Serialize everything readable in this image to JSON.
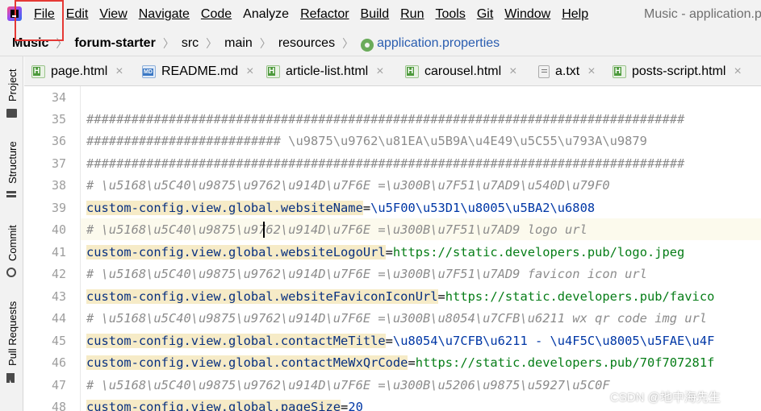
{
  "menubar": {
    "items": [
      {
        "label": "File"
      },
      {
        "label": "Edit"
      },
      {
        "label": "View"
      },
      {
        "label": "Navigate"
      },
      {
        "label": "Code"
      },
      {
        "label": "Analyze"
      },
      {
        "label": "Refactor"
      },
      {
        "label": "Build"
      },
      {
        "label": "Run"
      },
      {
        "label": "Tools"
      },
      {
        "label": "Git"
      },
      {
        "label": "Window"
      },
      {
        "label": "Help"
      }
    ],
    "window_title": "Music - application.p"
  },
  "breadcrumb": {
    "project": "Music",
    "module": "forum-starter",
    "dir1": "src",
    "dir2": "main",
    "dir3": "resources",
    "file": "application.properties",
    "file_icon": "gear-icon"
  },
  "toolstrip": {
    "project": "Project",
    "structure": "Structure",
    "commit": "Commit",
    "pull_requests": "Pull Requests"
  },
  "tabs": [
    {
      "label": "page.html",
      "icon": "html-file-icon"
    },
    {
      "label": "README.md",
      "icon": "markdown-file-icon"
    },
    {
      "label": "article-list.html",
      "icon": "html-file-icon"
    },
    {
      "label": "carousel.html",
      "icon": "html-file-icon"
    },
    {
      "label": "a.txt",
      "icon": "text-file-icon"
    },
    {
      "label": "posts-script.html",
      "icon": "html-file-icon"
    }
  ],
  "editor": {
    "lines": [
      {
        "no": "34",
        "text": ""
      },
      {
        "no": "35",
        "text": "################################################################################"
      },
      {
        "no": "36",
        "text": "########################## \\u9875\\u9762\\u81EA\\u5B9A\\u4E49\\u5C55\\u793A\\u9879"
      },
      {
        "no": "37",
        "text": "################################################################################"
      },
      {
        "no": "38",
        "text": "# \\u5168\\u5C40\\u9875\\u9762\\u914D\\u7F6E =\\u300B\\u7F51\\u7AD9\\u540D\\u79F0"
      },
      {
        "no": "39",
        "key": "custom-config.view.global.websiteName",
        "value": "\\u5F00\\u53D1\\u8005\\u5BA2\\u6808"
      },
      {
        "no": "40",
        "text": "# \\u5168\\u5C40\\u9875\\u9762\\u914D\\u7F6E =\\u300B\\u7F51\\u7AD9 logo url"
      },
      {
        "no": "41",
        "key": "custom-config.view.global.websiteLogoUrl",
        "value": "https://static.developers.pub/logo.jpeg"
      },
      {
        "no": "42",
        "text": "# \\u5168\\u5C40\\u9875\\u9762\\u914D\\u7F6E =\\u300B\\u7F51\\u7AD9 favicon icon url"
      },
      {
        "no": "43",
        "key": "custom-config.view.global.websiteFaviconIconUrl",
        "value": "https://static.developers.pub/favico"
      },
      {
        "no": "44",
        "text": "# \\u5168\\u5C40\\u9875\\u9762\\u914D\\u7F6E =\\u300B\\u8054\\u7CFB\\u6211 wx qr code img url"
      },
      {
        "no": "45",
        "key": "custom-config.view.global.contactMeTitle",
        "value": "\\u8054\\u7CFB\\u6211 - \\u4F5C\\u8005\\u5FAE\\u4F"
      },
      {
        "no": "46",
        "key": "custom-config.view.global.contactMeWxQrCode",
        "value": "https://static.developers.pub/70f707281f"
      },
      {
        "no": "47",
        "text": "# \\u5168\\u5C40\\u9875\\u9762\\u914D\\u7F6E =\\u300B\\u5206\\u9875\\u5927\\u5C0F"
      },
      {
        "no": "48",
        "key": "custom-config.view.global.pageSize",
        "value": "20"
      }
    ]
  },
  "watermark": "CSDN @地中海先生",
  "colors": {
    "chrome_bg": "#f2f2f2",
    "key_highlight": "#f6ebc7",
    "key_text": "#083080",
    "value_text": "#067d17",
    "escaped_value_text": "#0037a6",
    "comment_text": "#8c8c8c",
    "highlight_box": "#e53935"
  }
}
